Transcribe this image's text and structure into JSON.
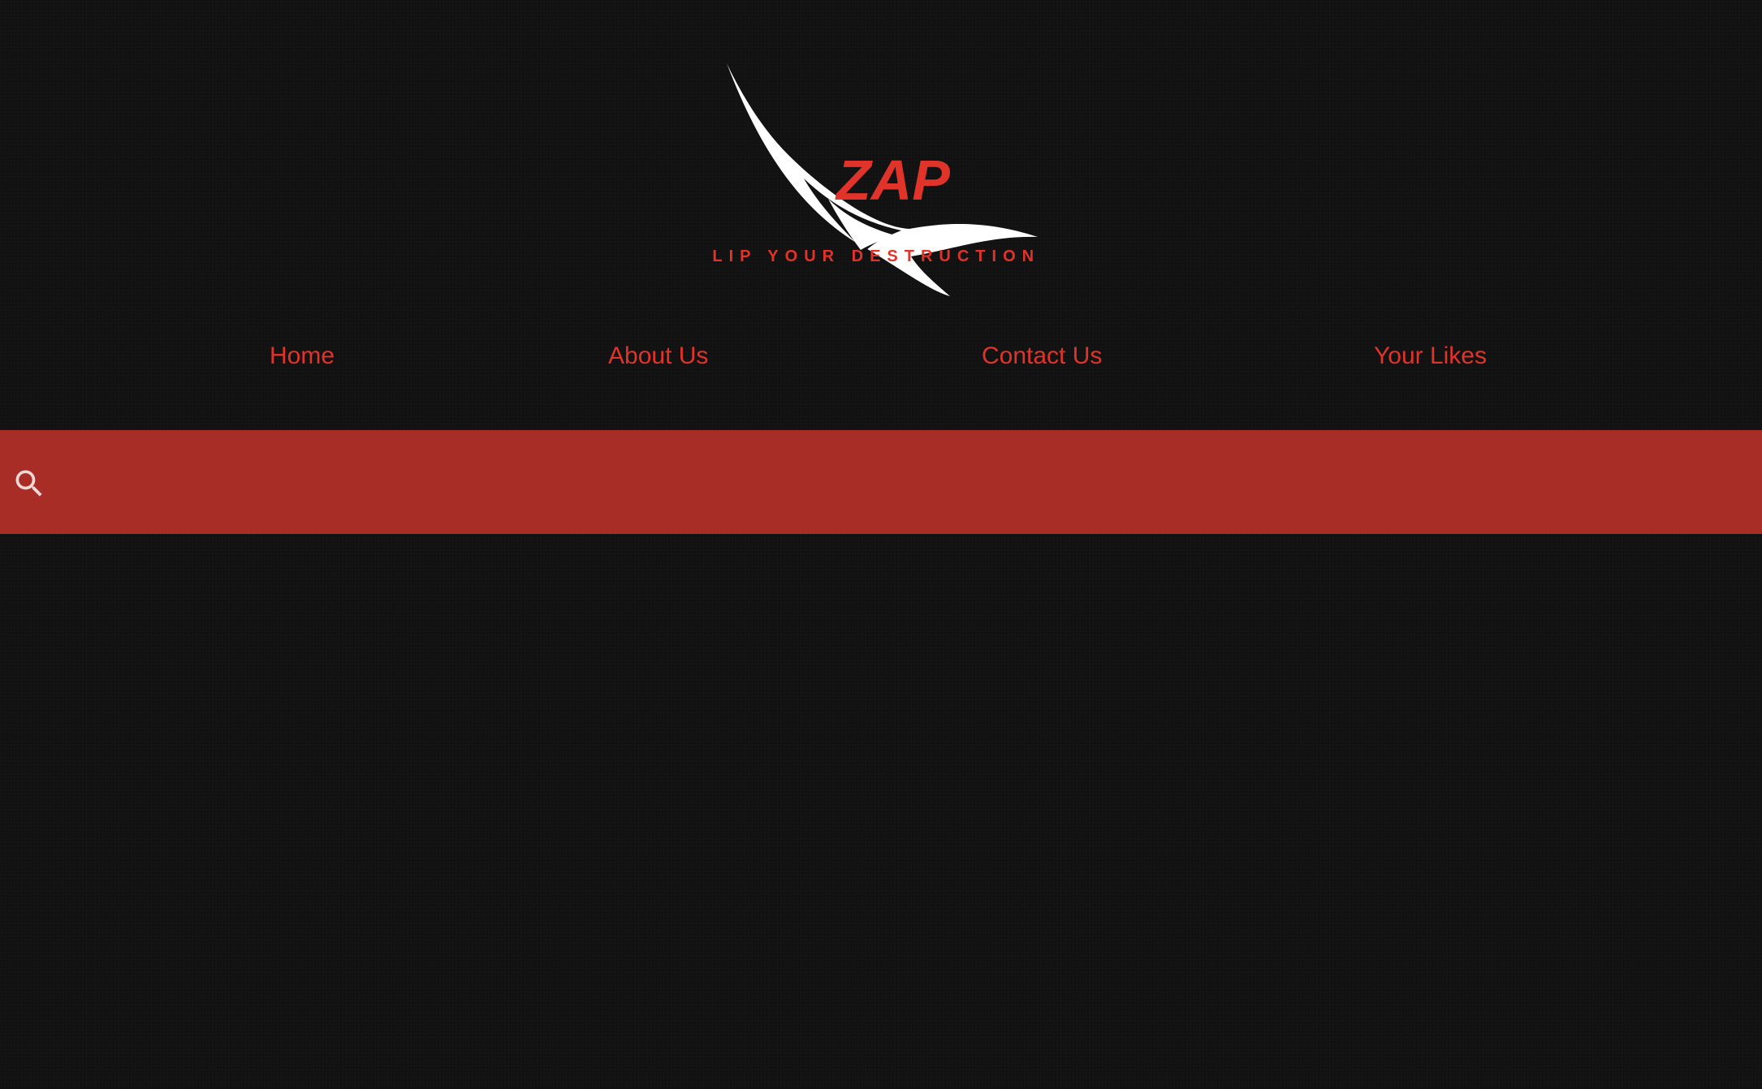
{
  "brand": {
    "name": "ZAP",
    "tagline": "CLIP YOUR DESTRUCTION"
  },
  "nav": {
    "items": [
      {
        "label": "Home"
      },
      {
        "label": "About Us"
      },
      {
        "label": "Contact Us"
      },
      {
        "label": "Your Likes"
      }
    ]
  },
  "search": {
    "icon": "search-icon",
    "value": "",
    "placeholder": ""
  },
  "colors": {
    "background": "#121212",
    "accent": "#e0332a",
    "search_bar": "#a82d26",
    "logo_swoosh": "#ffffff"
  }
}
